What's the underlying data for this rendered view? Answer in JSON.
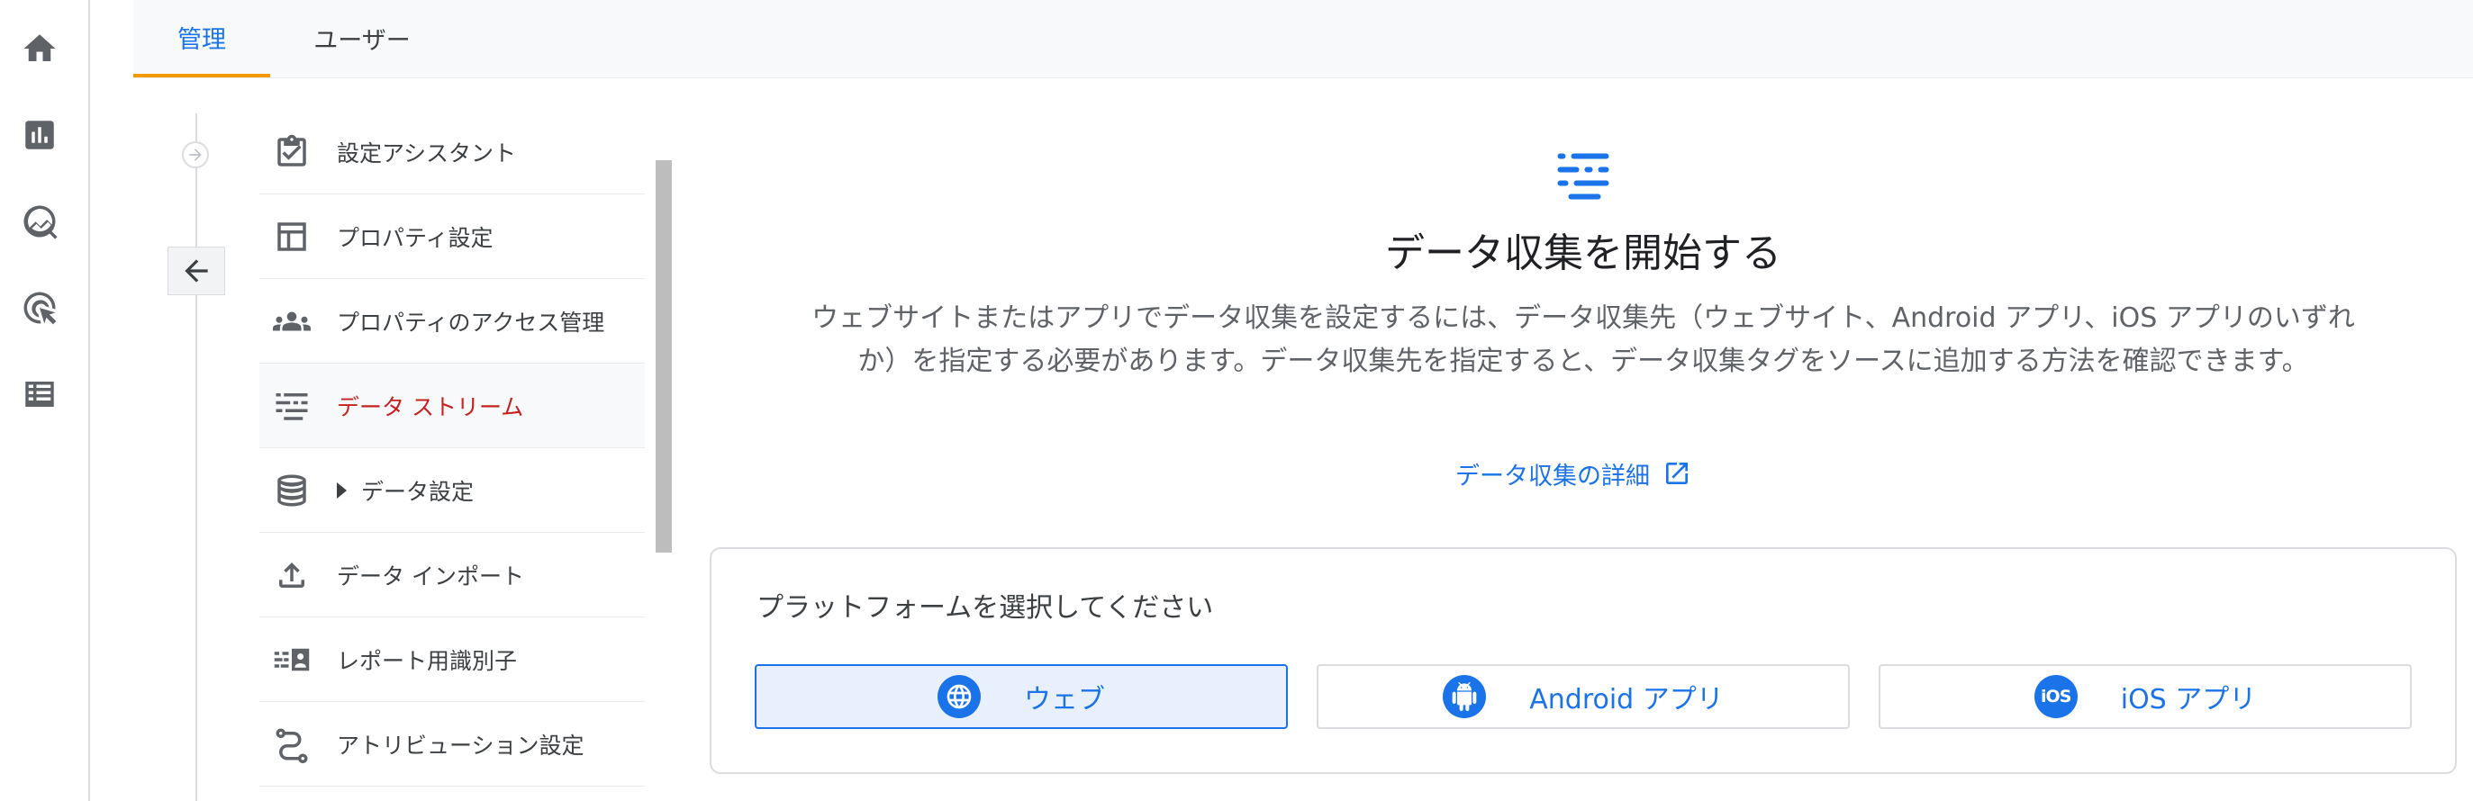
{
  "tabs": [
    {
      "label": "管理",
      "active": true
    },
    {
      "label": "ユーザー",
      "active": false
    }
  ],
  "rail": {
    "items": [
      {
        "icon": "home-icon"
      },
      {
        "icon": "reports-icon"
      },
      {
        "icon": "explore-icon"
      },
      {
        "icon": "advertising-icon"
      },
      {
        "icon": "configure-icon"
      }
    ]
  },
  "sidebar": {
    "items": [
      {
        "label": "設定アシスタント",
        "icon": "setup-assistant-icon"
      },
      {
        "label": "プロパティ設定",
        "icon": "property-settings-icon"
      },
      {
        "label": "プロパティのアクセス管理",
        "icon": "people-icon"
      },
      {
        "label": "データ ストリーム",
        "icon": "data-streams-icon",
        "active": true
      },
      {
        "label": "データ設定",
        "icon": "database-icon",
        "expandable": true
      },
      {
        "label": "データ インポート",
        "icon": "upload-icon"
      },
      {
        "label": "レポート用識別子",
        "icon": "identity-icon"
      },
      {
        "label": "アトリビューション設定",
        "icon": "attribution-icon"
      }
    ]
  },
  "main": {
    "title": "データ収集を開始する",
    "description": "ウェブサイトまたはアプリでデータ収集を設定するには、データ収集先（ウェブサイト、Android アプリ、iOS アプリのいずれか）を指定する必要があります。データ収集先を指定すると、データ収集タグをソースに追加する方法を確認できます。",
    "learn_more": "データ収集の詳細",
    "platform": {
      "heading": "プラットフォームを選択してください",
      "options": [
        {
          "label": "ウェブ",
          "icon": "globe-icon",
          "selected": true
        },
        {
          "label": "Android アプリ",
          "icon": "android-icon",
          "selected": false
        },
        {
          "label": "iOS アプリ",
          "icon": "ios-icon",
          "badge_text": "iOS",
          "selected": false
        }
      ]
    }
  },
  "colors": {
    "accent": "#1a73e8",
    "active_nav_text": "#c5221f",
    "tab_indicator": "#f29900"
  }
}
